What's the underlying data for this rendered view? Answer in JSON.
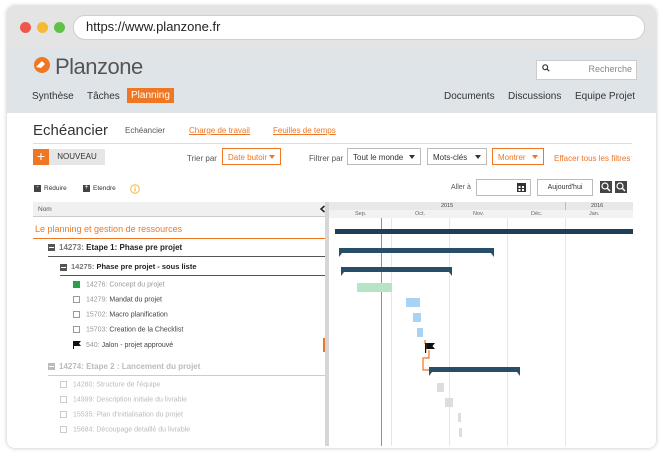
{
  "browser": {
    "url": "https://www.planzone.fr"
  },
  "app": {
    "brand": "Planzone",
    "search_placeholder": "Recherche",
    "nav_left": [
      "Synthèse",
      "Tâches",
      "Planning"
    ],
    "nav_right": [
      "Documents",
      "Discussions",
      "Equipe Projet"
    ]
  },
  "page": {
    "title": "Echéancier",
    "subtabs": [
      "Echéancier",
      "Charge de travail",
      "Feuilles de temps"
    ]
  },
  "toolbar": {
    "new_label": "NOUVEAU",
    "sort_label": "Trier par",
    "sort_value": "Date butoir",
    "filter_label": "Filtrer par",
    "filter_people": "Tout le monde",
    "filter_keywords": "Mots-clés",
    "show_label": "Montrer",
    "clear_filters": "Effacer tous les filtres"
  },
  "gantt_tools": {
    "reduce": "Réduire",
    "expand": "Etendre",
    "goto_label": "Aller à",
    "today_label": "Aujourd'hui"
  },
  "table": {
    "col_name": "Nom",
    "rows": [
      {
        "text": "Le planning et gestion de ressources"
      },
      {
        "id": "14273:",
        "text": "Etape 1: Phase pre projet"
      },
      {
        "id": "14275:",
        "text": "Phase pre projet - sous liste"
      },
      {
        "id": "14276:",
        "text": "Concept du projet"
      },
      {
        "id": "14279:",
        "text": "Mandat du projet"
      },
      {
        "id": "15702:",
        "text": "Macro planification"
      },
      {
        "id": "15703:",
        "text": "Creation de la Checklist"
      },
      {
        "id": "540:",
        "text": "Jalon - projet approuvé"
      },
      {
        "id": "14274:",
        "text": "Etape 2 : Lancement du projet"
      },
      {
        "id": "14280:",
        "text": "Structure de l'équipe"
      },
      {
        "id": "14999:",
        "text": "Description initiale du livrable"
      },
      {
        "id": "15535:",
        "text": "Plan d'initialisation du projet"
      },
      {
        "id": "15684:",
        "text": "Découpage detaillé du livrable"
      }
    ]
  },
  "timeline": {
    "years": [
      "2015",
      "2016"
    ],
    "months": [
      "Sep.",
      "Oct.",
      "Nov.",
      "Déc.",
      "Jan."
    ]
  },
  "colors": {
    "accent": "#ef7622",
    "summary_bar": "#264e69",
    "task_green": "#b7e4c7",
    "task_blue": "#a9d3f5",
    "task_grey": "#dddddd"
  }
}
